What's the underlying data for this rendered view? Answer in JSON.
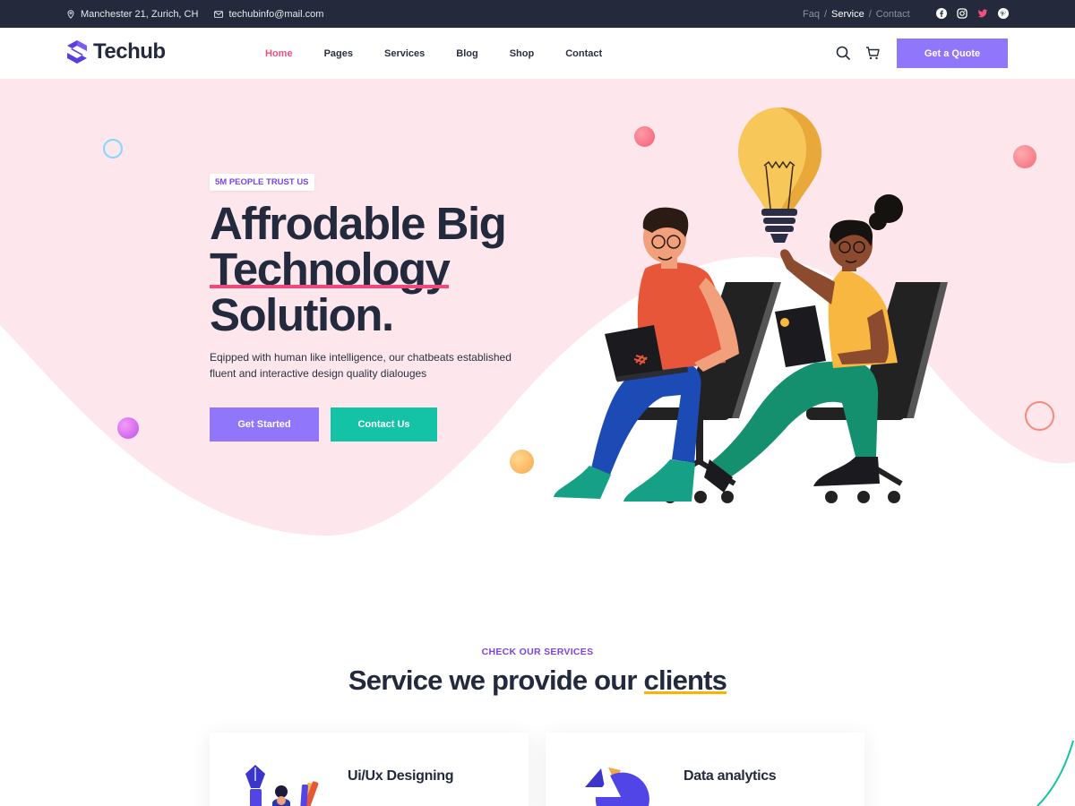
{
  "topbar": {
    "address": "Manchester 21, Zurich, CH",
    "email": "techubinfo@mail.com",
    "links": [
      {
        "label": "Faq"
      },
      {
        "label": "Service"
      },
      {
        "label": "Contact"
      }
    ],
    "separator": "/",
    "social_icons": [
      "facebook-icon",
      "instagram-icon",
      "twitter-icon",
      "pinterest-icon"
    ]
  },
  "header": {
    "logo_text": "Techub",
    "nav": [
      {
        "label": "Home",
        "active": true
      },
      {
        "label": "Pages"
      },
      {
        "label": "Services"
      },
      {
        "label": "Blog"
      },
      {
        "label": "Shop"
      },
      {
        "label": "Contact"
      }
    ],
    "icons": [
      "search-icon",
      "cart-icon"
    ],
    "cta_label": "Get a Quote"
  },
  "hero": {
    "badge": "5M PEOPLE TRUST US",
    "title_line1": "Affrodable Big",
    "title_line2": "Technology",
    "title_line3": "Solution.",
    "description": "Eqipped with human like intelligence, our chatbeats established fluent and interactive design quality dialouges",
    "primary_button": "Get Started",
    "secondary_button": "Contact Us"
  },
  "services": {
    "kicker": "CHECK OUR SERVICES",
    "title_prefix": "Service we provide our ",
    "title_highlight": "clients",
    "cards": [
      {
        "title": "Ui/Ux Designing",
        "icon": "pen-tool-icon"
      },
      {
        "title": "Data analytics",
        "icon": "pie-chart-icon"
      }
    ]
  },
  "colors": {
    "topbar_bg": "#242a3c",
    "accent_purple": "#8f76fa",
    "accent_teal": "#14c3a6",
    "accent_pink": "#f04a7d",
    "hero_bg": "#fde6ec",
    "highlight_yellow": "#f8b400"
  }
}
